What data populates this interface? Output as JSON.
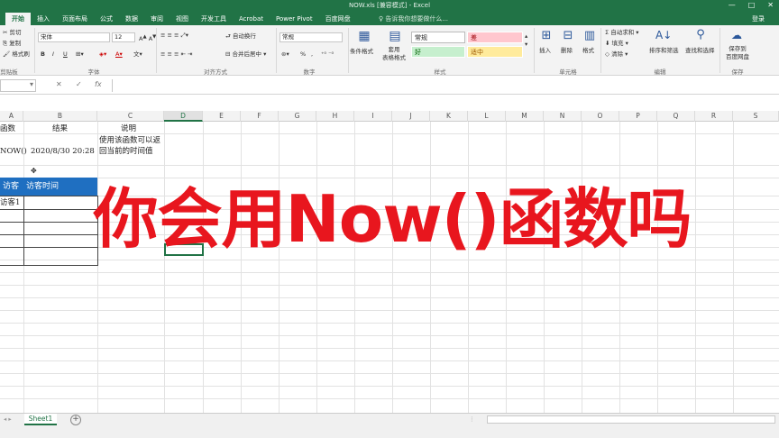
{
  "window": {
    "title": "NOW.xls [兼容模式] - Excel",
    "controls": [
      "—",
      "□",
      "✕"
    ]
  },
  "tabs": [
    "开始",
    "插入",
    "页面布局",
    "公式",
    "数据",
    "审阅",
    "视图",
    "开发工具",
    "Acrobat",
    "Power Pivot",
    "百度网盘"
  ],
  "tell_me": "♀ 告诉我你想要做什么...",
  "login": "登录",
  "ribbon": {
    "clipboard": {
      "cut": "剪切",
      "copy": "复制",
      "format_painter": "格式刷",
      "label": "剪贴板"
    },
    "font": {
      "name": "宋体",
      "size": "12",
      "bold": "B",
      "italic": "I",
      "underline": "U",
      "label": "字体"
    },
    "alignment": {
      "wrap": "自动换行",
      "merge": "合并后居中",
      "label": "对齐方式"
    },
    "number": {
      "format": "常规",
      "percent": "%",
      "comma": ",",
      "label": "数字"
    },
    "styles": {
      "conditional": "条件格式",
      "table": "套用\n表格格式",
      "cells": [
        {
          "text": "常规",
          "bg": "#ffffff",
          "fg": "#333333"
        },
        {
          "text": "差",
          "bg": "#ffc7ce",
          "fg": "#9c0006"
        },
        {
          "text": "好",
          "bg": "#c6efce",
          "fg": "#006100"
        },
        {
          "text": "适中",
          "bg": "#ffeb9c",
          "fg": "#9c5700"
        }
      ],
      "label": "样式"
    },
    "cells_group": {
      "insert": "插入",
      "delete": "删除",
      "format": "格式",
      "label": "单元格"
    },
    "editing": {
      "autosum": "自动求和",
      "fill": "填充",
      "clear": "清除",
      "sort": "排序和筛选",
      "find": "查找和选择",
      "label": "编辑"
    },
    "save": {
      "btn": "保存到\n百度网盘",
      "label": "保存"
    }
  },
  "formula_bar": {
    "name_box": "",
    "fx": "fx",
    "cancel": "✕",
    "enter": "✓"
  },
  "columns": [
    "A",
    "B",
    "C",
    "D",
    "E",
    "F",
    "G",
    "H",
    "I",
    "J",
    "K",
    "L",
    "M",
    "N",
    "O",
    "P",
    "Q",
    "R",
    "S"
  ],
  "cells": {
    "a_head": "函数",
    "b_head": "结果",
    "c_head": "说明",
    "a_func": "NOW()",
    "b_result": "2020/8/30 20:28",
    "c_desc": "使用该函数可以返回当前的时间值",
    "table_h1": "访客",
    "table_h2": "访客时间",
    "visitor1": "访客1"
  },
  "overlay_text": "你会用Now()函数吗",
  "sheet": {
    "name": "Sheet1",
    "add": "+"
  }
}
